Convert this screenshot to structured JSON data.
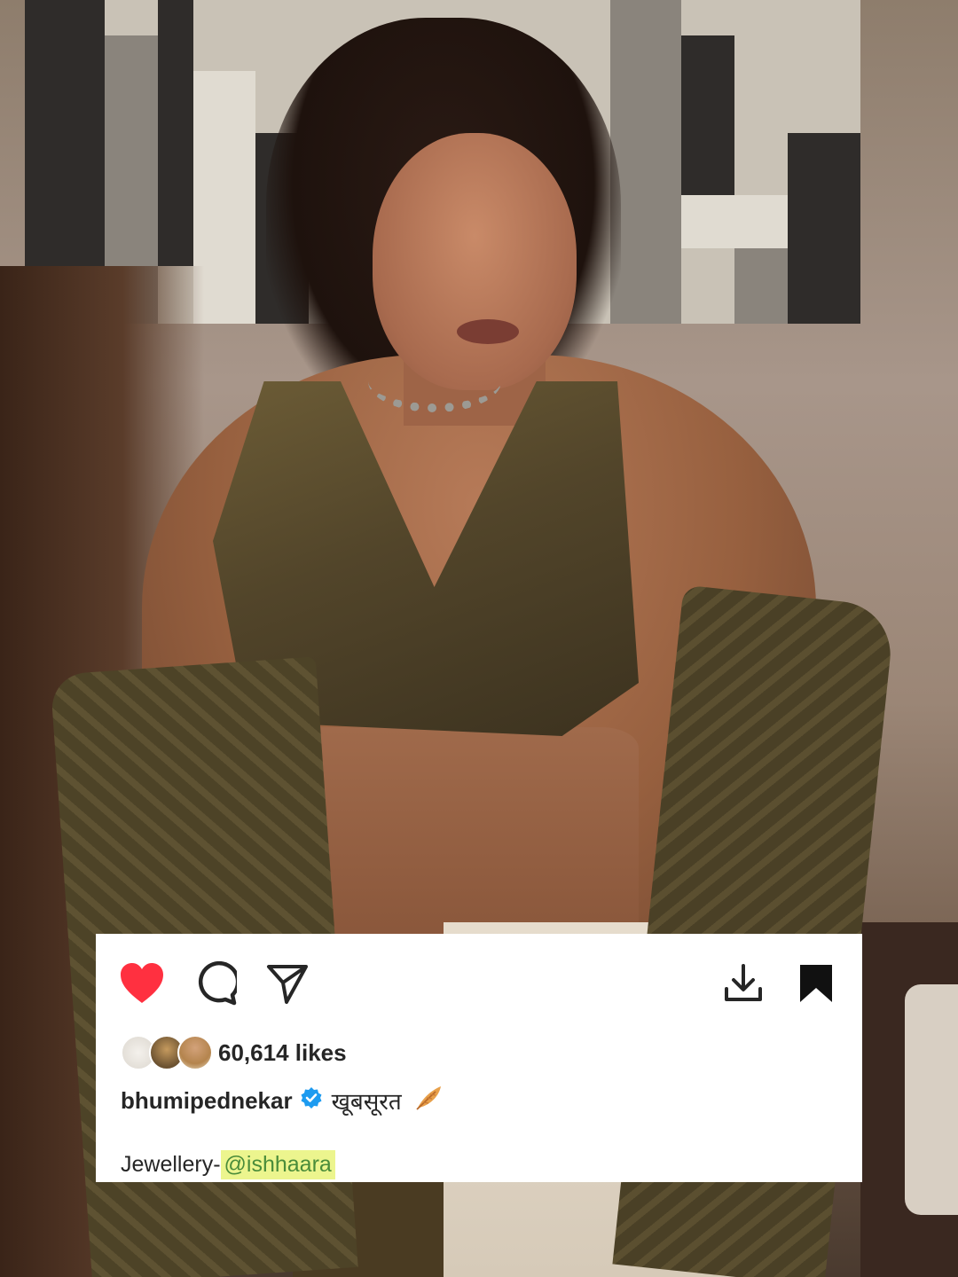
{
  "post": {
    "likes_text": "60,614 likes",
    "username": "bhumipednekar",
    "caption": "खूबसूरत",
    "credit_label": "Jewellery-",
    "credit_mention": "@ishhaara"
  },
  "icons": {
    "like": "heart-filled-icon",
    "comment": "comment-bubble-icon",
    "share": "paper-plane-icon",
    "download": "download-icon",
    "save": "bookmark-filled-icon",
    "verified": "verified-badge-icon",
    "emoji": "feather-icon"
  },
  "colors": {
    "like_red": "#ff3040",
    "verified_blue": "#1d9bf0",
    "text": "#262626",
    "mention_highlight": "#ecf58e",
    "mention_text": "#4a8c3a"
  }
}
